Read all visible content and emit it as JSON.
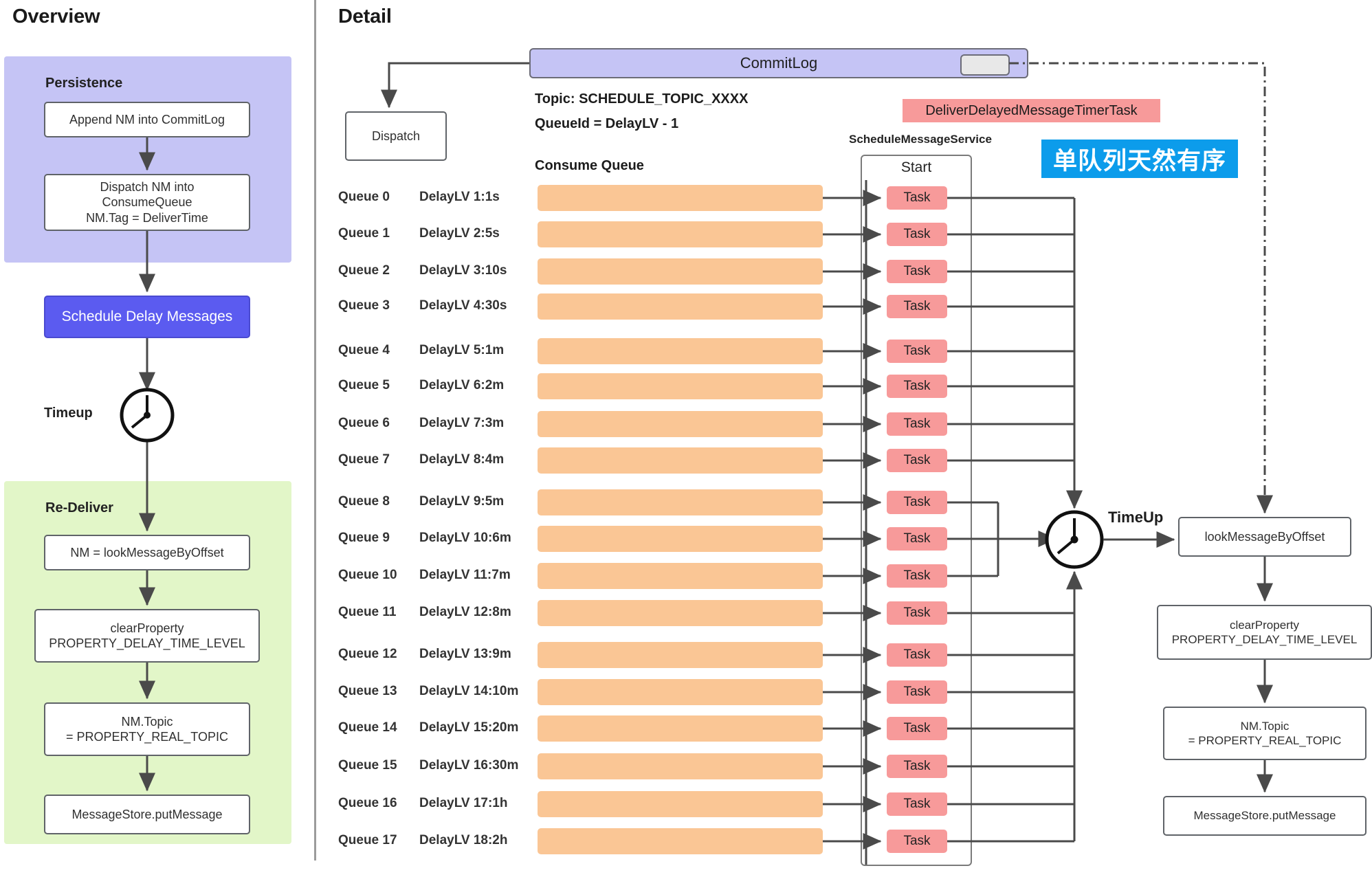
{
  "overview": {
    "title": "Overview",
    "persistence": {
      "label": "Persistence",
      "color": "#c5c4f5",
      "steps": [
        "Append NM into CommitLog",
        "Dispatch NM into\nConsumeQueue\nNM.Tag = DeliverTime"
      ]
    },
    "schedule_node": "Schedule Delay Messages",
    "schedule_color": "#5b5bf0",
    "timeup_label": "Timeup",
    "timeup_icon": "clock-icon",
    "redeliver": {
      "label": "Re-Deliver",
      "color": "#e2f6c8",
      "steps": [
        "NM = lookMessageByOffset",
        "clearProperty\nPROPERTY_DELAY_TIME_LEVEL",
        "NM.Topic\n= PROPERTY_REAL_TOPIC",
        "MessageStore.putMessage"
      ]
    }
  },
  "detail": {
    "title": "Detail",
    "commitlog": {
      "label": "CommitLog",
      "color": "#c5c4f5"
    },
    "dispatch": "Dispatch",
    "topic_line": "Topic: SCHEDULE_TOPIC_XXXX",
    "queueid_line": "QueueId = DelayLV - 1",
    "consume_queue_label": "Consume Queue",
    "timer_task_badge": {
      "label": "DeliverDelayedMessageTimerTask",
      "color": "#f79a9a"
    },
    "annotation_badge": {
      "label": "单队列天然有序",
      "color": "#0c9ceb"
    },
    "schedule_service": {
      "caption": "ScheduleMessageService",
      "start_label": "Start",
      "task_label": "Task"
    },
    "queues": [
      {
        "name": "Queue 0",
        "delay": "DelayLV 1:1s"
      },
      {
        "name": "Queue 1",
        "delay": "DelayLV 2:5s"
      },
      {
        "name": "Queue 2",
        "delay": "DelayLV 3:10s"
      },
      {
        "name": "Queue 3",
        "delay": "DelayLV 4:30s"
      },
      {
        "name": "Queue 4",
        "delay": "DelayLV 5:1m"
      },
      {
        "name": "Queue 5",
        "delay": "DelayLV 6:2m"
      },
      {
        "name": "Queue 6",
        "delay": "DelayLV 7:3m"
      },
      {
        "name": "Queue 7",
        "delay": "DelayLV 8:4m"
      },
      {
        "name": "Queue 8",
        "delay": "DelayLV 9:5m"
      },
      {
        "name": "Queue 9",
        "delay": "DelayLV 10:6m"
      },
      {
        "name": "Queue 10",
        "delay": "DelayLV 11:7m"
      },
      {
        "name": "Queue 11",
        "delay": "DelayLV 12:8m"
      },
      {
        "name": "Queue 12",
        "delay": "DelayLV 13:9m"
      },
      {
        "name": "Queue 13",
        "delay": "DelayLV 14:10m"
      },
      {
        "name": "Queue 14",
        "delay": "DelayLV 15:20m"
      },
      {
        "name": "Queue 15",
        "delay": "DelayLV 16:30m"
      },
      {
        "name": "Queue 16",
        "delay": "DelayLV 17:1h"
      },
      {
        "name": "Queue 17",
        "delay": "DelayLV 18:2h"
      }
    ],
    "timeup_label": "TimeUp",
    "timeup_icon": "clock-icon",
    "right_flow": [
      "lookMessageByOffset",
      "clearProperty\nPROPERTY_DELAY_TIME_LEVEL",
      "NM.Topic\n= PROPERTY_REAL_TOPIC",
      "MessageStore.putMessage"
    ]
  }
}
